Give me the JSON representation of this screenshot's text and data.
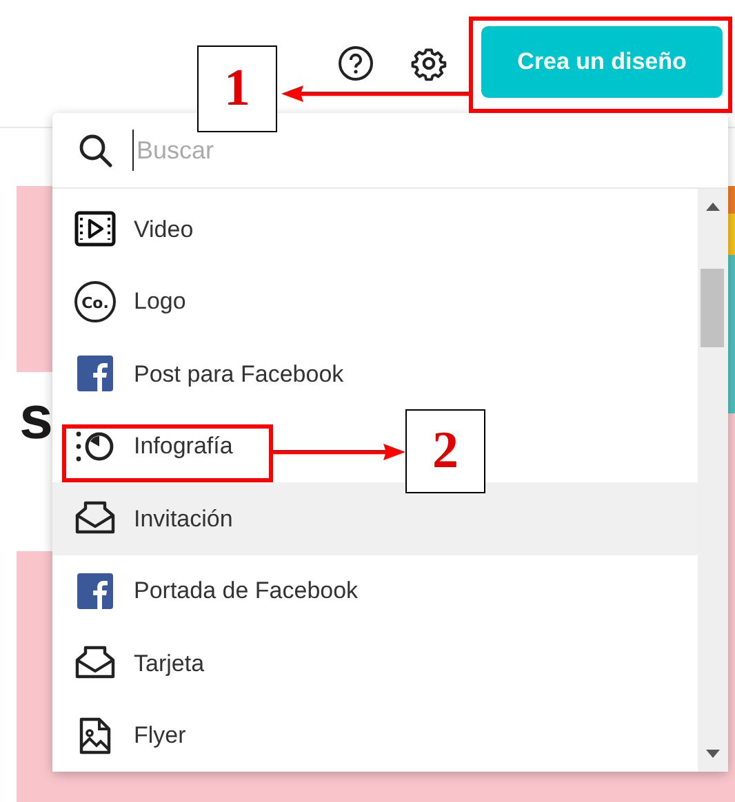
{
  "header": {
    "create_button": "Crea un diseño"
  },
  "background": {
    "heading_fragment": "s"
  },
  "menu": {
    "search": {
      "placeholder": "Buscar"
    },
    "items": [
      {
        "label": "Video",
        "kind": "video",
        "highlighted": false
      },
      {
        "label": "Logo",
        "kind": "logo",
        "icon_text": "Co.",
        "highlighted": false
      },
      {
        "label": "Post para Facebook",
        "kind": "facebook",
        "highlighted": false
      },
      {
        "label": "Infografía",
        "kind": "infographic",
        "highlighted": false
      },
      {
        "label": "Invitación",
        "kind": "envelope",
        "highlighted": true
      },
      {
        "label": "Portada de Facebook",
        "kind": "facebook",
        "highlighted": false
      },
      {
        "label": "Tarjeta",
        "kind": "envelope",
        "highlighted": false
      },
      {
        "label": "Flyer",
        "kind": "flyer",
        "highlighted": false
      }
    ]
  },
  "annotations": [
    {
      "label": "1"
    },
    {
      "label": "2"
    }
  ]
}
